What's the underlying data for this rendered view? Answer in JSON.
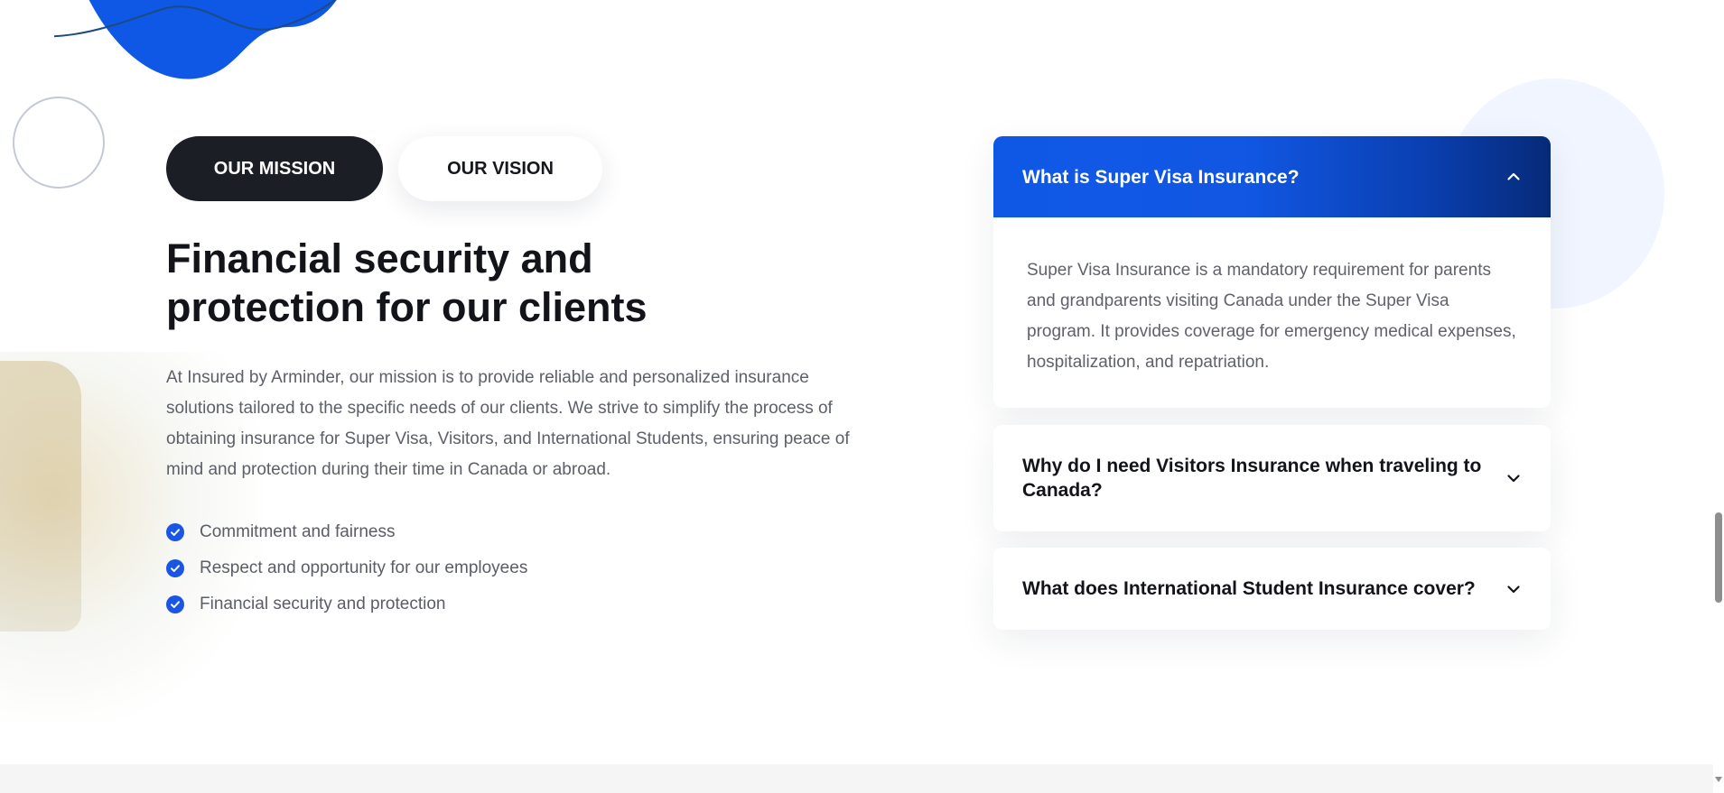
{
  "tabs": {
    "mission_label": "OUR MISSION",
    "vision_label": "OUR VISION"
  },
  "mission": {
    "headline_line1": "Financial security and",
    "headline_line2": "protection for our clients",
    "intro": "At Insured by Arminder, our mission is to provide reliable and personalized insurance solutions tailored to the specific needs of our clients. We strive to simplify the process of obtaining insurance for Super Visa, Visitors, and International Students, ensuring peace of mind and protection during their time in Canada or abroad.",
    "features": [
      "Commitment and fairness",
      "Respect and opportunity for our employees",
      "Financial security and protection"
    ]
  },
  "faq": [
    {
      "question": "What is Super Visa Insurance?",
      "answer": "Super Visa Insurance is a mandatory requirement for parents and grandparents visiting Canada under the Super Visa program. It provides coverage for emergency medical expenses, hospitalization, and repatriation.",
      "expanded": true,
      "icon": "chevron-up-icon"
    },
    {
      "question": "Why do I need Visitors Insurance when traveling to Canada?",
      "expanded": false,
      "icon": "chevron-down-icon"
    },
    {
      "question": "What does International Student Insurance cover?",
      "expanded": false,
      "icon": "chevron-down-icon"
    }
  ],
  "colors": {
    "accent_blue": "#1157e4",
    "accent_blue_dark": "#062a78",
    "dark_button": "#1b1e25",
    "check_blue": "#1a55e3",
    "body_text": "#5d6068"
  },
  "icons": {
    "feature_bullet": "check-circle-icon",
    "decor_blob": "blob-shape",
    "decor_ring": "ring-shape"
  }
}
